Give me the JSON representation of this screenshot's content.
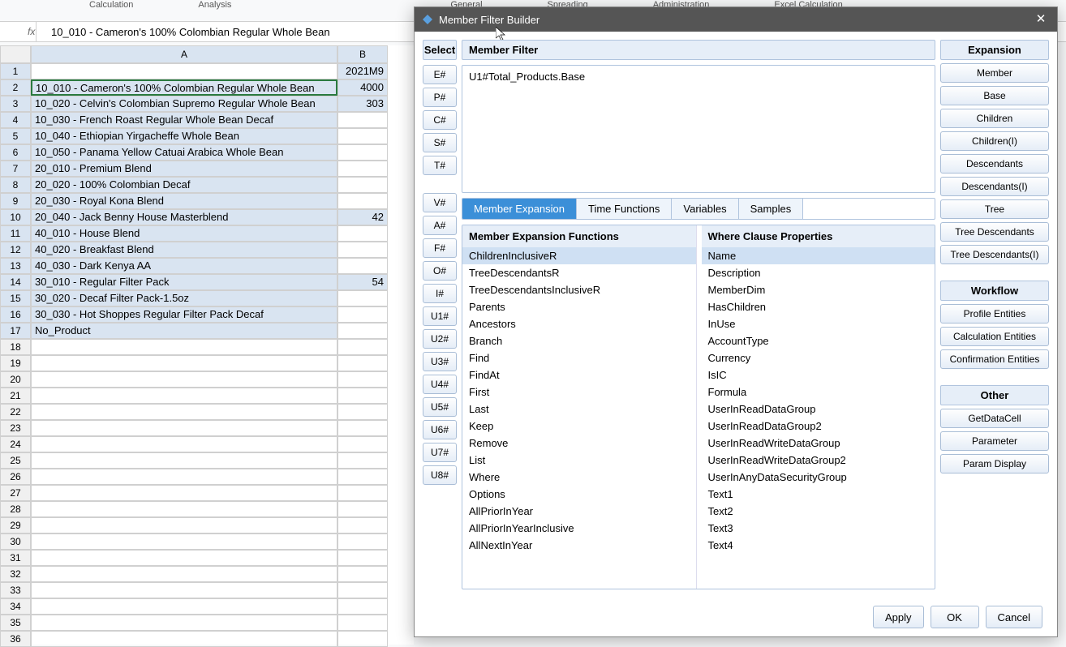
{
  "ribbon": {
    "items": [
      "Calculation",
      "Analysis",
      "General",
      "Spreading",
      "Administration",
      "Excel Calculation"
    ]
  },
  "formula_bar": {
    "fx": "fx",
    "value": "10_010 - Cameron's 100% Colombian Regular Whole Bean"
  },
  "sheet": {
    "col_a": "A",
    "col_b": "B",
    "header_b_value": "2021M9",
    "rows": [
      {
        "n": 1,
        "a": "",
        "b": "2021M9",
        "is_header": true
      },
      {
        "n": 2,
        "a": "10_010 - Cameron's 100% Colombian Regular Whole Bean",
        "b": "4000",
        "selected": true
      },
      {
        "n": 3,
        "a": "10_020 - Celvin's Colombian Supremo Regular Whole Bean",
        "b": "303"
      },
      {
        "n": 4,
        "a": "10_030 - French Roast Regular Whole Bean Decaf",
        "b": ""
      },
      {
        "n": 5,
        "a": "10_040 - Ethiopian Yirgacheffe Whole Bean",
        "b": ""
      },
      {
        "n": 6,
        "a": "10_050 - Panama Yellow Catuai Arabica Whole Bean",
        "b": ""
      },
      {
        "n": 7,
        "a": "20_010 - Premium Blend",
        "b": ""
      },
      {
        "n": 8,
        "a": "20_020 - 100% Colombian Decaf",
        "b": ""
      },
      {
        "n": 9,
        "a": "20_030 - Royal Kona Blend",
        "b": ""
      },
      {
        "n": 10,
        "a": "20_040 - Jack Benny House Masterblend",
        "b": "42"
      },
      {
        "n": 11,
        "a": "40_010 - House Blend",
        "b": ""
      },
      {
        "n": 12,
        "a": "40_020 - Breakfast Blend",
        "b": ""
      },
      {
        "n": 13,
        "a": "40_030 - Dark Kenya AA",
        "b": ""
      },
      {
        "n": 14,
        "a": "30_010 - Regular Filter Pack",
        "b": "54"
      },
      {
        "n": 15,
        "a": "30_020 - Decaf Filter Pack-1.5oz",
        "b": ""
      },
      {
        "n": 16,
        "a": "30_030 - Hot Shoppes Regular Filter Pack Decaf",
        "b": ""
      },
      {
        "n": 17,
        "a": "No_Product",
        "b": ""
      }
    ],
    "blank_rows": [
      18,
      19,
      20,
      21,
      22,
      23,
      24,
      25,
      26,
      27,
      28,
      29,
      30,
      31,
      32,
      33,
      34,
      35,
      36
    ]
  },
  "dialog": {
    "title": "Member Filter Builder",
    "select_header": "Select",
    "dim_buttons_1": [
      "E#",
      "P#",
      "C#",
      "S#",
      "T#"
    ],
    "dim_buttons_2": [
      "V#",
      "A#",
      "F#",
      "O#",
      "I#",
      "U1#",
      "U2#",
      "U3#",
      "U4#",
      "U5#",
      "U6#",
      "U7#",
      "U8#"
    ],
    "filter_header": "Member Filter",
    "filter_value": "U1#Total_Products.Base",
    "tabs": [
      "Member Expansion",
      "Time Functions",
      "Variables",
      "Samples"
    ],
    "active_tab": 0,
    "left_list_title": "Member Expansion Functions",
    "left_list": [
      "ChildrenInclusiveR",
      "TreeDescendantsR",
      "TreeDescendantsInclusiveR",
      "Parents",
      "Ancestors",
      "Branch",
      "Find",
      "FindAt",
      "First",
      "Last",
      "Keep",
      "Remove",
      "List",
      "Where",
      "Options",
      "AllPriorInYear",
      "AllPriorInYearInclusive",
      "AllNextInYear"
    ],
    "left_selected": 0,
    "right_list_title": "Where Clause Properties",
    "right_list": [
      "Name",
      "Description",
      "MemberDim",
      "HasChildren",
      "InUse",
      "AccountType",
      "Currency",
      "IsIC",
      "Formula",
      "UserInReadDataGroup",
      "UserInReadDataGroup2",
      "UserInReadWriteDataGroup",
      "UserInReadWriteDataGroup2",
      "UserInAnyDataSecurityGroup",
      "Text1",
      "Text2",
      "Text3",
      "Text4"
    ],
    "right_selected": 0,
    "groups": {
      "expansion": {
        "header": "Expansion",
        "buttons": [
          "Member",
          "Base",
          "Children",
          "Children(I)",
          "Descendants",
          "Descendants(I)",
          "Tree",
          "Tree Descendants",
          "Tree Descendants(I)"
        ]
      },
      "workflow": {
        "header": "Workflow",
        "buttons": [
          "Profile Entities",
          "Calculation Entities",
          "Confirmation Entities"
        ]
      },
      "other": {
        "header": "Other",
        "buttons": [
          "GetDataCell",
          "Parameter",
          "Param Display"
        ]
      }
    },
    "footer": {
      "apply": "Apply",
      "ok": "OK",
      "cancel": "Cancel"
    }
  }
}
